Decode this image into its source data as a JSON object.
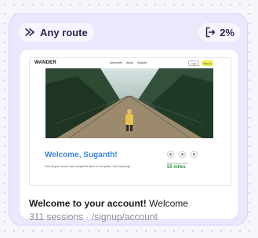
{
  "route_badge": {
    "label": "Any route",
    "icon": "route-arrows-icon"
  },
  "exit_badge": {
    "label": "2%",
    "icon": "exit-door-icon"
  },
  "preview": {
    "logo": "WANDER",
    "nav_links": [
      "Adventure",
      "About",
      "Support"
    ],
    "login_label": "Login",
    "signup_label": "Sign up",
    "welcome_text": "Welcome, Suganth!",
    "subtext": "Find all your saved and completed hikes in one place. Get exploring!",
    "stat_label": "Total distance hiked",
    "stat_value": "55 miles",
    "colors": {
      "welcome": "#3c86e0",
      "signup": "#ecf050",
      "stat": "#2b9a3d"
    }
  },
  "page": {
    "title_bold": "Welcome to your account!",
    "title_plain": "Welcome",
    "sessions": "311 sessions",
    "separator": "·",
    "path": "/signup/account"
  },
  "colors": {
    "card": "#ebe7fd",
    "badge_text": "#2d2552"
  }
}
